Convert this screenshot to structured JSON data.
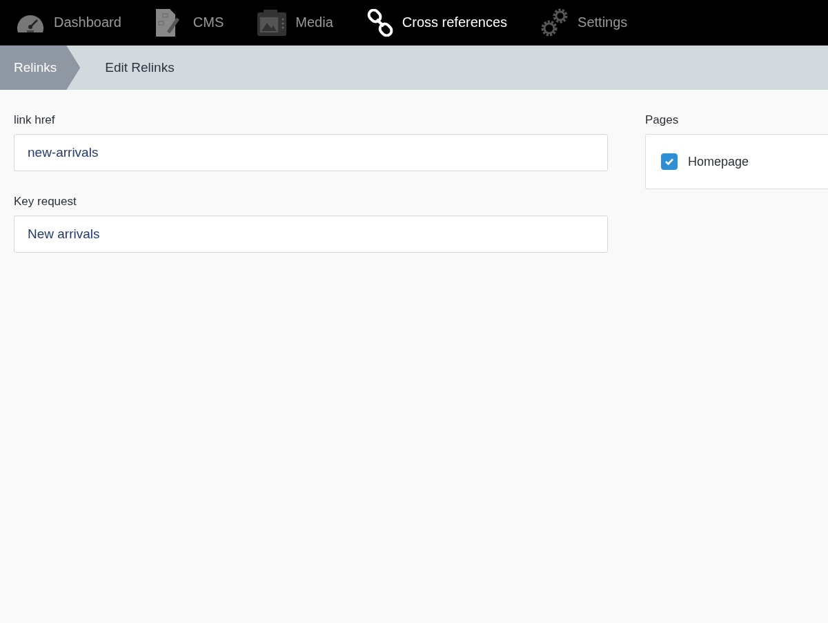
{
  "nav": [
    {
      "label": "Dashboard",
      "selected": false
    },
    {
      "label": "CMS",
      "selected": false
    },
    {
      "label": "Media",
      "selected": false
    },
    {
      "label": "Cross references",
      "selected": true
    },
    {
      "label": "Settings",
      "selected": false
    }
  ],
  "breadcrumb": [
    {
      "label": "Relinks",
      "selected": false
    },
    {
      "label": "Edit Relinks",
      "selected": true
    }
  ],
  "fields": [
    {
      "label": "link href",
      "value": "new-arrivals"
    },
    {
      "label": "Key request",
      "value": "New arrivals"
    }
  ],
  "pages": {
    "label": "Pages",
    "items": [
      {
        "label": "Homepage",
        "checked": true
      }
    ]
  }
}
